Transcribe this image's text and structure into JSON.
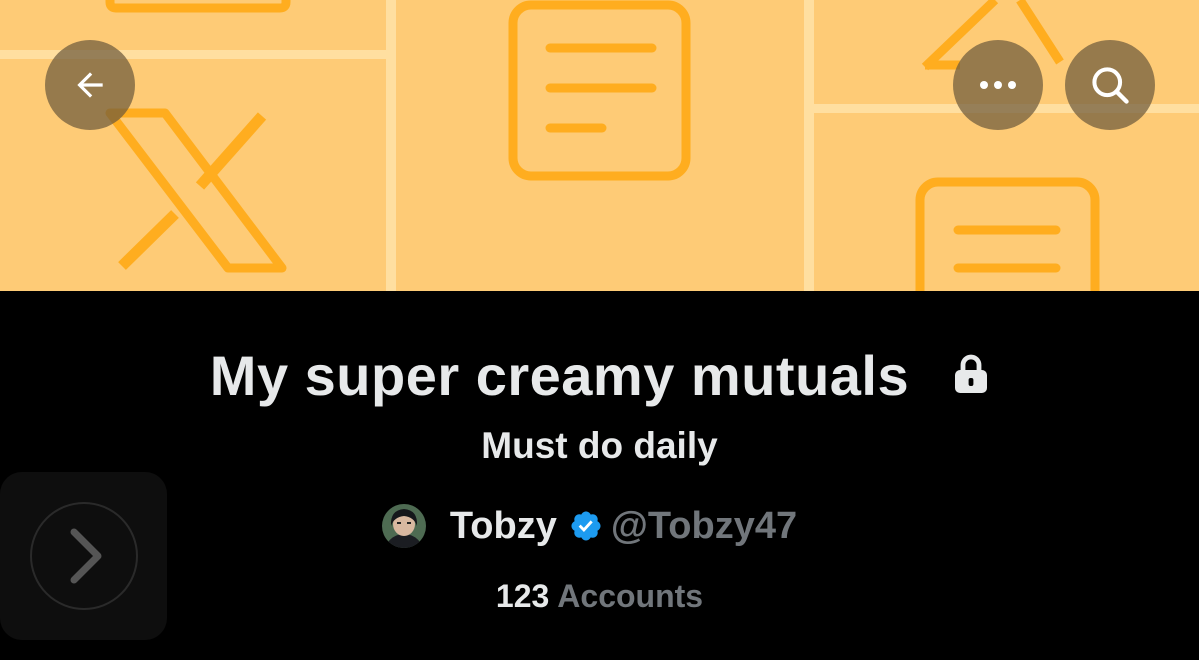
{
  "list": {
    "title": "My super creamy mutuals",
    "description": "Must do daily",
    "owner_name": "Tobzy",
    "owner_handle": "@Tobzy47",
    "member_count": "123",
    "member_label": "Accounts"
  },
  "icons": {
    "back": "arrow-left-icon",
    "more": "more-horizontal-icon",
    "search": "search-icon",
    "private": "lock-icon",
    "verified": "verified-badge-icon",
    "next": "chevron-right-icon"
  },
  "colors": {
    "banner_bg": "#fecb76",
    "banner_art": "#ffad1f",
    "text_primary": "#e7e9ea",
    "text_secondary": "#71767b",
    "verified": "#1d9bf0",
    "background": "#000000"
  }
}
